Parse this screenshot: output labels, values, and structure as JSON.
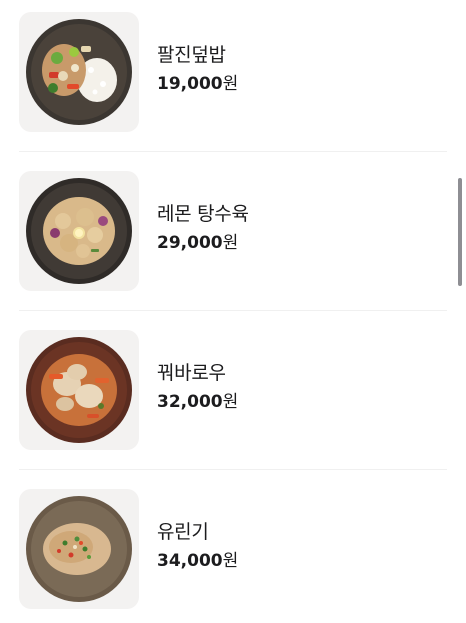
{
  "menu": {
    "items": [
      {
        "name": "팔진덮밥",
        "price": "19,000",
        "currency": "원",
        "image": "palchin-rice-bowl-photo"
      },
      {
        "name": "레몬 탕수육",
        "price": "29,000",
        "currency": "원",
        "image": "lemon-sweet-sour-pork-photo"
      },
      {
        "name": "꿔바로우",
        "price": "32,000",
        "currency": "원",
        "image": "guobaorou-photo"
      },
      {
        "name": "유린기",
        "price": "34,000",
        "currency": "원",
        "image": "yuringi-fried-chicken-photo"
      }
    ]
  },
  "colors": {
    "text": "#1c1c1e",
    "thumb_bg": "#f3f2f1",
    "divider": "#f0f0f0",
    "scrollbar": "#8e8e93"
  }
}
